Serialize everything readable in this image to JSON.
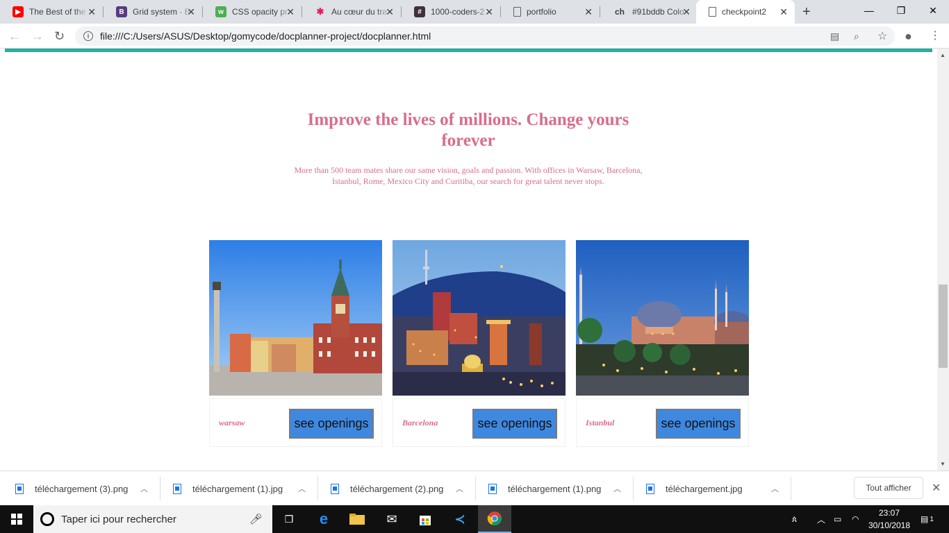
{
  "browser": {
    "tabs": [
      {
        "title": "The Best of the",
        "icon": "youtube-icon"
      },
      {
        "title": "Grid system · B",
        "icon": "bootstrap-icon"
      },
      {
        "title": "CSS opacity pr",
        "icon": "w3schools-icon"
      },
      {
        "title": "Au cœur du tra",
        "icon": "slack-icon"
      },
      {
        "title": "1000-coders-2",
        "icon": "channel-hash-icon"
      },
      {
        "title": "portfolio",
        "icon": "page-icon"
      },
      {
        "title": "#91bddb Colo",
        "icon": "colorhexa-icon"
      },
      {
        "title": "checkpoint2",
        "icon": "page-icon"
      }
    ],
    "address": "file:///C:/Users/ASUS/Desktop/gomycode/docplanner-project/docplanner.html"
  },
  "page": {
    "title": "Improve the lives of millions. Change yours forever",
    "subtitle": "More than 500 team mates share our same vision, goals and passion. With offices in Warsaw, Barcelona, Istanbul, Rome, Mexico City and Curitiba, our search for great talent never stops.",
    "cards": [
      {
        "city": "warsaw",
        "button": "see openings"
      },
      {
        "city": "Barcelona",
        "button": "see openings"
      },
      {
        "city": "Istanbul",
        "button": "see openings"
      }
    ],
    "colors": {
      "accent": "#d96d8a",
      "teal": "#1ab3a0",
      "button": "#3f88e0"
    }
  },
  "downloads": {
    "items": [
      "téléchargement (3).png",
      "téléchargement (1).jpg",
      "téléchargement (2).png",
      "téléchargement (1).png",
      "téléchargement.jpg"
    ],
    "show_all": "Tout afficher"
  },
  "taskbar": {
    "search_placeholder": "Taper ici pour rechercher",
    "time": "23:07",
    "date": "30/10/2018",
    "notifications": "1"
  }
}
